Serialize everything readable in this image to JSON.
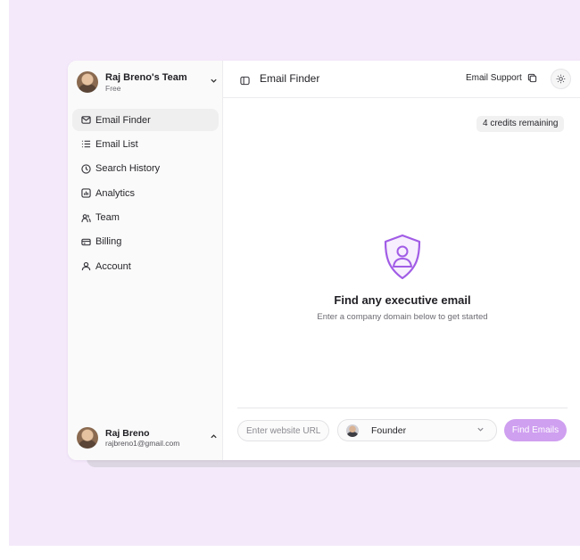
{
  "team": {
    "name": "Raj Breno's Team",
    "plan": "Free",
    "chevron": "chevron-down"
  },
  "sidebar": {
    "items": [
      {
        "label": "Email Finder",
        "icon": "mail-icon",
        "active": true
      },
      {
        "label": "Email List",
        "icon": "list-icon",
        "active": false
      },
      {
        "label": "Search History",
        "icon": "clock-icon",
        "active": false
      },
      {
        "label": "Analytics",
        "icon": "analytics-icon",
        "active": false
      },
      {
        "label": "Team",
        "icon": "team-icon",
        "active": false
      },
      {
        "label": "Billing",
        "icon": "card-icon",
        "active": false
      },
      {
        "label": "Account",
        "icon": "user-icon",
        "active": false
      }
    ]
  },
  "user": {
    "name": "Raj Breno",
    "email": "rajbreno1@gmail.com",
    "chevron": "chevron-up"
  },
  "header": {
    "title": "Email Finder",
    "support_label": "Email Support"
  },
  "credits": {
    "label": "4 credits remaining"
  },
  "empty_state": {
    "title": "Find any executive email",
    "subtitle": "Enter a company domain below to get started",
    "icon": "shield-user-icon"
  },
  "search": {
    "url_placeholder": "Enter website URL",
    "role_value": "Founder",
    "submit_label": "Find Emails"
  },
  "colors": {
    "background": "#f4e9fb",
    "accent": "#cf9ff0",
    "shield": "#a15ce6"
  }
}
